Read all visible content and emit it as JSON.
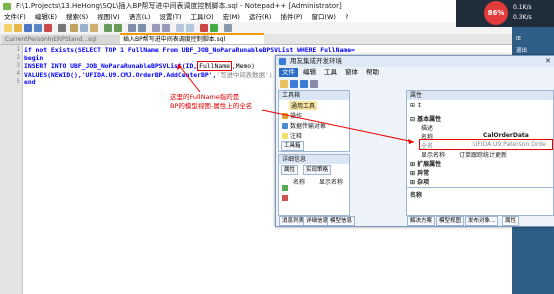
{
  "npp": {
    "title": "F:\\1.Projects\\13.HeHong\\SQL\\插入BP帮写进中间表调度控制脚本.sql - Notepad++ [Administrator]",
    "menu": [
      "文件(F)",
      "编辑(E)",
      "搜索(S)",
      "视图(V)",
      "语言(L)",
      "设置(T)",
      "工具(O)",
      "宏(M)",
      "运行(R)",
      "插件(P)",
      "窗口(W)",
      "?"
    ],
    "tabs": [
      "CurrentPersonInERPStand...sql",
      "插入BP帮写进中间表调度控制脚本.sql"
    ],
    "lines": [
      {
        "n": "1",
        "a": "if not Exists(SELECT TOP 1 FullName From UBF_JOB_NoParaRunableBPSVList WHERE FullName=",
        "b": ""
      },
      {
        "n": "2",
        "a": "begin",
        "b": ""
      },
      {
        "n": "3",
        "a": "INSERT INTO UBF_JOB_NoParaRunableBPSVList(ID,",
        "boxed": "FullName",
        "b": ",Memo)"
      },
      {
        "n": "4",
        "a": "VALUES(NEWID(),'UFIDA.U9.CMJ.OrderBP.AddCenterBP',",
        "b": "'写进中间表数据')"
      },
      {
        "n": "5",
        "a": "end",
        "b": ""
      }
    ]
  },
  "annotation": {
    "text1": "这里的FullName指的是",
    "text2": "BP的模型视图-属性上的全名",
    "color": "#e00000"
  },
  "builder": {
    "title": "用友集成开发环境",
    "menu": [
      "文件",
      "编辑",
      "工具",
      "窗体",
      "帮助"
    ],
    "toolbox": {
      "header": "工具箱",
      "sub": "通用工具",
      "items": [
        "操作",
        "数据传输对象",
        "注释"
      ],
      "tab": "工具箱"
    },
    "details": {
      "header": "详细信息",
      "tabs": [
        "属性",
        "实现策略"
      ],
      "col1": "名称",
      "col2": "显示名称"
    },
    "details_tabs": [
      "消息列表",
      "详细信息",
      "模型信息"
    ],
    "properties": {
      "header": "属性",
      "group1": "基本属性",
      "rows": [
        {
          "k": "描述",
          "v": ""
        },
        {
          "k": "名称",
          "v": "CalOrderData"
        },
        {
          "k": "全名",
          "v": "UFIDA.U9.Paterson.Orde"
        },
        {
          "k": "显示名称",
          "v": "订单跟踪统计更新"
        }
      ],
      "group2": "扩展属性",
      "group3": "异常",
      "group4": "杂项",
      "desc_title": "名称",
      "bottom_tabs": [
        "解决方案",
        "模型视图",
        "发布对象...",
        "属性"
      ]
    }
  },
  "monitor": {
    "percent": "86%",
    "up": "0.1K/s",
    "down": "0.3K/s"
  },
  "desktop": {
    "labels": [
      "IE",
      "退出",
      "设置",
      "全屏"
    ]
  }
}
